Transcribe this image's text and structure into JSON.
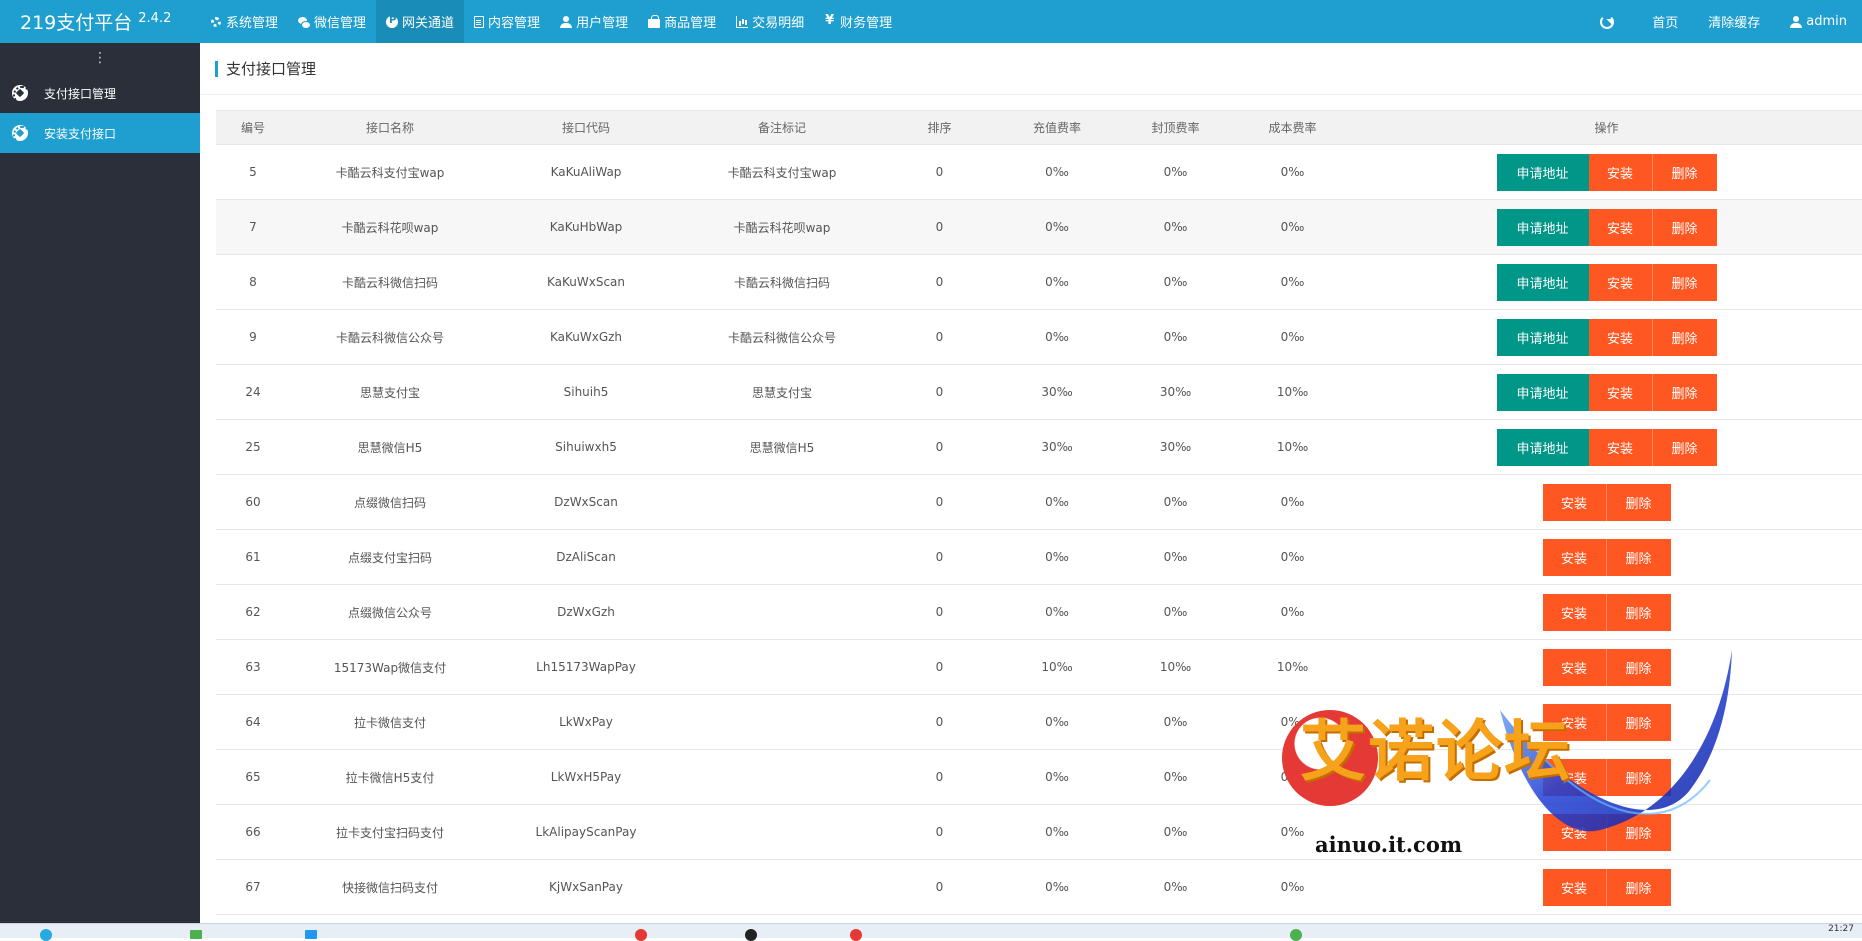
{
  "brand": {
    "name": "219支付平台",
    "version": "2.4.2"
  },
  "nav": [
    {
      "label": "系统管理",
      "icon": "gear-icon",
      "active": false
    },
    {
      "label": "微信管理",
      "icon": "wechat-icon",
      "active": false
    },
    {
      "label": "网关通道",
      "icon": "paypal-icon",
      "active": true
    },
    {
      "label": "内容管理",
      "icon": "document-icon",
      "active": false
    },
    {
      "label": "用户管理",
      "icon": "users-icon",
      "active": false
    },
    {
      "label": "商品管理",
      "icon": "shopping-bag-icon",
      "active": false
    },
    {
      "label": "交易明细",
      "icon": "bar-chart-icon",
      "active": false
    },
    {
      "label": "财务管理",
      "icon": "money-icon",
      "active": false
    }
  ],
  "top_right": {
    "home": "首页",
    "clear_cache": "清除缓存",
    "user": "admin"
  },
  "sidebar": {
    "toggle": "⋮",
    "items": [
      {
        "label": "支付接口管理",
        "active": false
      },
      {
        "label": "安装支付接口",
        "active": true
      }
    ]
  },
  "page": {
    "title": "支付接口管理"
  },
  "table": {
    "headers": [
      "编号",
      "接口名称",
      "接口代码",
      "备注标记",
      "排序",
      "充值费率",
      "封顶费率",
      "成本费率",
      "操作"
    ],
    "buttons": {
      "apply": "申请地址",
      "install": "安装",
      "delete": "删除"
    },
    "rows": [
      {
        "id": "5",
        "name": "卡酷云科支付宝wap",
        "code": "KaKuAliWap",
        "remark": "卡酷云科支付宝wap",
        "sort": "0",
        "recharge": "0‰",
        "cap": "0‰",
        "cost": "0‰",
        "has_apply": true
      },
      {
        "id": "7",
        "name": "卡酷云科花呗wap",
        "code": "KaKuHbWap",
        "remark": "卡酷云科花呗wap",
        "sort": "0",
        "recharge": "0‰",
        "cap": "0‰",
        "cost": "0‰",
        "has_apply": true
      },
      {
        "id": "8",
        "name": "卡酷云科微信扫码",
        "code": "KaKuWxScan",
        "remark": "卡酷云科微信扫码",
        "sort": "0",
        "recharge": "0‰",
        "cap": "0‰",
        "cost": "0‰",
        "has_apply": true
      },
      {
        "id": "9",
        "name": "卡酷云科微信公众号",
        "code": "KaKuWxGzh",
        "remark": "卡酷云科微信公众号",
        "sort": "0",
        "recharge": "0‰",
        "cap": "0‰",
        "cost": "0‰",
        "has_apply": true
      },
      {
        "id": "24",
        "name": "思慧支付宝",
        "code": "Sihuih5",
        "remark": "思慧支付宝",
        "sort": "0",
        "recharge": "30‰",
        "cap": "30‰",
        "cost": "10‰",
        "has_apply": true
      },
      {
        "id": "25",
        "name": "思慧微信H5",
        "code": "Sihuiwxh5",
        "remark": "思慧微信H5",
        "sort": "0",
        "recharge": "30‰",
        "cap": "30‰",
        "cost": "10‰",
        "has_apply": true
      },
      {
        "id": "60",
        "name": "点缀微信扫码",
        "code": "DzWxScan",
        "remark": "",
        "sort": "0",
        "recharge": "0‰",
        "cap": "0‰",
        "cost": "0‰",
        "has_apply": false
      },
      {
        "id": "61",
        "name": "点缀支付宝扫码",
        "code": "DzAliScan",
        "remark": "",
        "sort": "0",
        "recharge": "0‰",
        "cap": "0‰",
        "cost": "0‰",
        "has_apply": false
      },
      {
        "id": "62",
        "name": "点缀微信公众号",
        "code": "DzWxGzh",
        "remark": "",
        "sort": "0",
        "recharge": "0‰",
        "cap": "0‰",
        "cost": "0‰",
        "has_apply": false
      },
      {
        "id": "63",
        "name": "15173Wap微信支付",
        "code": "Lh15173WapPay",
        "remark": "",
        "sort": "0",
        "recharge": "10‰",
        "cap": "10‰",
        "cost": "10‰",
        "has_apply": false
      },
      {
        "id": "64",
        "name": "拉卡微信支付",
        "code": "LkWxPay",
        "remark": "",
        "sort": "0",
        "recharge": "0‰",
        "cap": "0‰",
        "cost": "0‰",
        "has_apply": false
      },
      {
        "id": "65",
        "name": "拉卡微信H5支付",
        "code": "LkWxH5Pay",
        "remark": "",
        "sort": "0",
        "recharge": "0‰",
        "cap": "0‰",
        "cost": "0‰",
        "has_apply": false
      },
      {
        "id": "66",
        "name": "拉卡支付宝扫码支付",
        "code": "LkAlipayScanPay",
        "remark": "",
        "sort": "0",
        "recharge": "0‰",
        "cap": "0‰",
        "cost": "0‰",
        "has_apply": false
      },
      {
        "id": "67",
        "name": "快接微信扫码支付",
        "code": "KjWxSanPay",
        "remark": "",
        "sort": "0",
        "recharge": "0‰",
        "cap": "0‰",
        "cost": "0‰",
        "has_apply": false
      }
    ]
  },
  "watermark": {
    "text": "艾诺论坛",
    "url": "ainuo.it.com"
  },
  "taskbar": {
    "clock": "21:27"
  },
  "colors": {
    "topbar": "#1e9fd0",
    "sidebar": "#2b2f3a",
    "apply_button": "#009688",
    "action_button": "#ff5722"
  }
}
